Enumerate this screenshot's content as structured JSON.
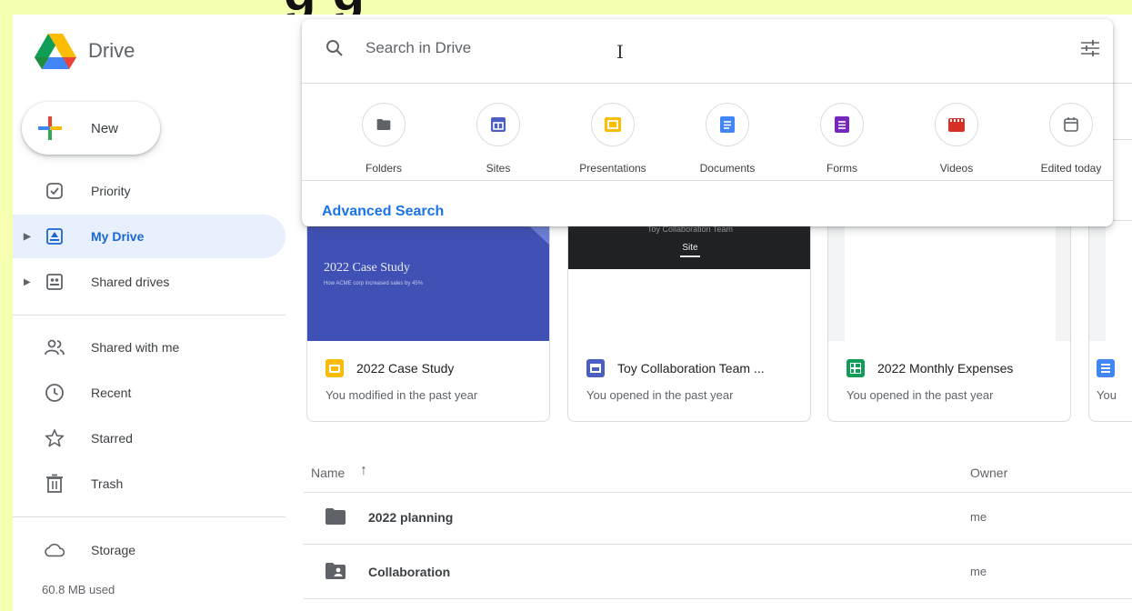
{
  "banner": {
    "text": "g   g"
  },
  "app": {
    "name": "Drive"
  },
  "new_button": {
    "label": "New"
  },
  "sidebar": {
    "items": [
      {
        "label": "Priority",
        "icon": "priority-icon"
      },
      {
        "label": "My Drive",
        "icon": "my-drive-icon",
        "active": true
      },
      {
        "label": "Shared drives",
        "icon": "shared-drives-icon"
      },
      {
        "label": "Shared with me",
        "icon": "shared-with-me-icon"
      },
      {
        "label": "Recent",
        "icon": "clock-icon"
      },
      {
        "label": "Starred",
        "icon": "star-icon"
      },
      {
        "label": "Trash",
        "icon": "trash-icon"
      },
      {
        "label": "Storage",
        "icon": "cloud-icon"
      }
    ],
    "storage_used": "60.8 MB used"
  },
  "search": {
    "placeholder": "Search in Drive",
    "cursor_glyph": "I",
    "chips": [
      {
        "label": "Folders",
        "icon": "folder-icon"
      },
      {
        "label": "Sites",
        "icon": "sites-icon",
        "color": "#4a5fc1"
      },
      {
        "label": "Presentations",
        "icon": "slides-icon",
        "color": "#fbbc04"
      },
      {
        "label": "Documents",
        "icon": "docs-icon",
        "color": "#4285f4"
      },
      {
        "label": "Forms",
        "icon": "forms-icon",
        "color": "#7627bb"
      },
      {
        "label": "Videos",
        "icon": "video-icon",
        "color": "#d93025"
      },
      {
        "label": "Edited today",
        "icon": "calendar-icon"
      }
    ],
    "advanced_label": "Advanced Search"
  },
  "suggested": [
    {
      "title": "2022 Case Study",
      "subtitle": "You modified in the past year",
      "icon": "slides-icon",
      "thumb_title": "2022 Case Study",
      "thumb_sub": "How ACME corp increased sales by 45%"
    },
    {
      "title": "Toy Collaboration Team ...",
      "subtitle": "You opened in the past year",
      "icon": "sites-icon",
      "thumb_title": "Toy Collaboration Team",
      "thumb_sub": "Site"
    },
    {
      "title": "2022 Monthly Expenses",
      "subtitle": "You opened in the past year",
      "icon": "sheets-icon"
    },
    {
      "title": "",
      "subtitle": "You",
      "icon": "docs-icon"
    }
  ],
  "file_list": {
    "columns": {
      "name": "Name",
      "owner": "Owner"
    },
    "sort_arrow": "↑",
    "rows": [
      {
        "name": "2022 planning",
        "owner": "me",
        "icon": "folder-icon"
      },
      {
        "name": "Collaboration",
        "owner": "me",
        "icon": "shared-folder-icon"
      }
    ]
  },
  "colors": {
    "accent": "#1a73e8",
    "active_bg": "#e8f0fe",
    "banner_bg": "#f6ffb0",
    "case_study_thumb": "#3f51b5"
  }
}
